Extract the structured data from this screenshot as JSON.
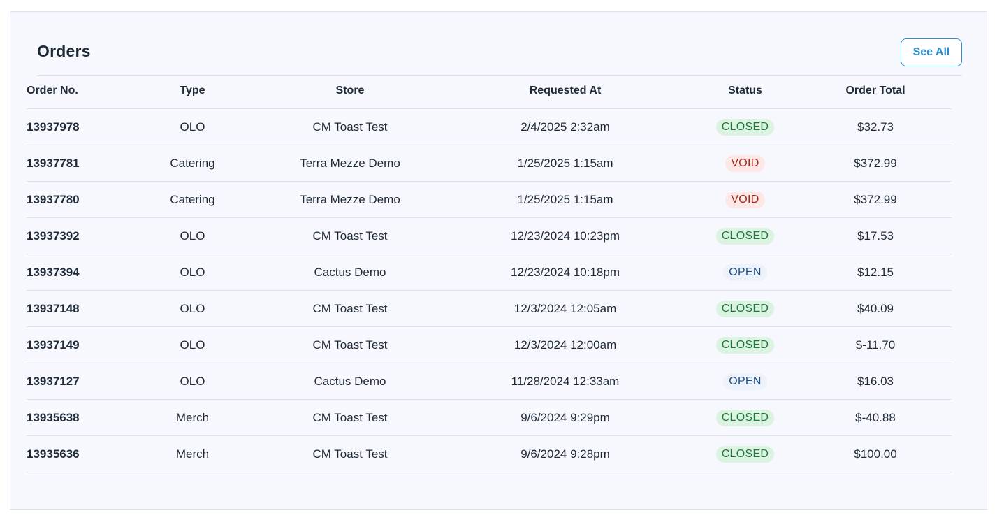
{
  "header": {
    "title": "Orders",
    "see_all_label": "See All"
  },
  "table": {
    "columns": [
      "Order No.",
      "Type",
      "Store",
      "Requested At",
      "Status",
      "Order Total"
    ],
    "rows": [
      {
        "order_no": "13937978",
        "type": "OLO",
        "store": "CM Toast Test",
        "requested_at": "2/4/2025 2:32am",
        "status": "CLOSED",
        "total": "$32.73"
      },
      {
        "order_no": "13937781",
        "type": "Catering",
        "store": "Terra Mezze Demo",
        "requested_at": "1/25/2025 1:15am",
        "status": "VOID",
        "total": "$372.99"
      },
      {
        "order_no": "13937780",
        "type": "Catering",
        "store": "Terra Mezze Demo",
        "requested_at": "1/25/2025 1:15am",
        "status": "VOID",
        "total": "$372.99"
      },
      {
        "order_no": "13937392",
        "type": "OLO",
        "store": "CM Toast Test",
        "requested_at": "12/23/2024 10:23pm",
        "status": "CLOSED",
        "total": "$17.53"
      },
      {
        "order_no": "13937394",
        "type": "OLO",
        "store": "Cactus Demo",
        "requested_at": "12/23/2024 10:18pm",
        "status": "OPEN",
        "total": "$12.15"
      },
      {
        "order_no": "13937148",
        "type": "OLO",
        "store": "CM Toast Test",
        "requested_at": "12/3/2024 12:05am",
        "status": "CLOSED",
        "total": "$40.09"
      },
      {
        "order_no": "13937149",
        "type": "OLO",
        "store": "CM Toast Test",
        "requested_at": "12/3/2024 12:00am",
        "status": "CLOSED",
        "total": "$-11.70"
      },
      {
        "order_no": "13937127",
        "type": "OLO",
        "store": "Cactus Demo",
        "requested_at": "11/28/2024 12:33am",
        "status": "OPEN",
        "total": "$16.03"
      },
      {
        "order_no": "13935638",
        "type": "Merch",
        "store": "CM Toast Test",
        "requested_at": "9/6/2024 9:29pm",
        "status": "CLOSED",
        "total": "$-40.88"
      },
      {
        "order_no": "13935636",
        "type": "Merch",
        "store": "CM Toast Test",
        "requested_at": "9/6/2024 9:28pm",
        "status": "CLOSED",
        "total": "$100.00"
      }
    ]
  },
  "colors": {
    "accent": "#2b8fd0",
    "closed_bg": "#dcf3e2",
    "closed_text": "#1a7a3c",
    "void_bg": "#fde8e6",
    "void_text": "#a12a1f",
    "open_bg": "#eef3fb",
    "open_text": "#1d4f86"
  }
}
